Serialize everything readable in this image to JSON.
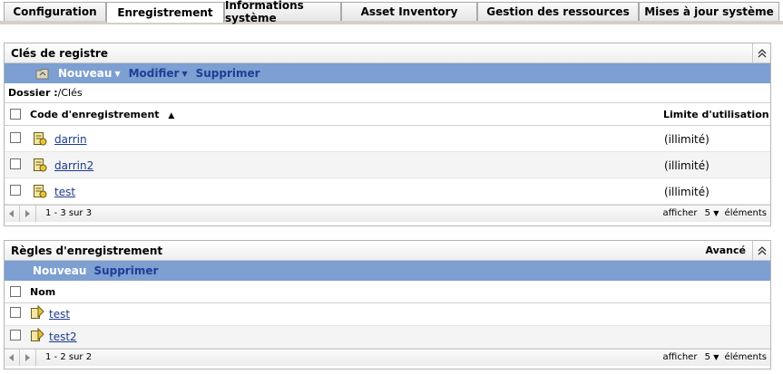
{
  "tabs": [
    "Configuration",
    "Enregistrement",
    "Informations système",
    "Asset Inventory",
    "Gestion des ressources",
    "Mises à jour système"
  ],
  "active_tab": "Enregistrement",
  "registry_keys": {
    "title": "Clés de registre",
    "toolbar": {
      "new_label": "Nouveau",
      "modify_label": "Modifier",
      "delete_label": "Supprimer"
    },
    "breadcrumb": {
      "label": "Dossier :",
      "path": "/Clés"
    },
    "columns": {
      "code": "Code d'enregistrement",
      "limit": "Limite d'utilisation"
    },
    "rows": [
      {
        "name": "darrin",
        "limit": "(illimité)"
      },
      {
        "name": "darrin2",
        "limit": "(illimité)"
      },
      {
        "name": "test",
        "limit": "(illimité)"
      }
    ],
    "pagination": "1 - 3 sur 3",
    "show_label": "afficher",
    "show_count": "5",
    "items_label": "éléments"
  },
  "registration_rules": {
    "title": "Règles d'enregistrement",
    "advanced_label": "Avancé",
    "toolbar": {
      "new_label": "Nouveau",
      "delete_label": "Supprimer"
    },
    "columns": {
      "name": "Nom"
    },
    "rows": [
      {
        "name": "test"
      },
      {
        "name": "test2"
      }
    ],
    "pagination": "1 - 2 sur 2",
    "show_label": "afficher",
    "show_count": "5",
    "items_label": "éléments"
  },
  "colors": {
    "toolbar_bg": "#7d9fd2",
    "link": "#1a3a8a",
    "alt_row": "#f4f4f4"
  }
}
